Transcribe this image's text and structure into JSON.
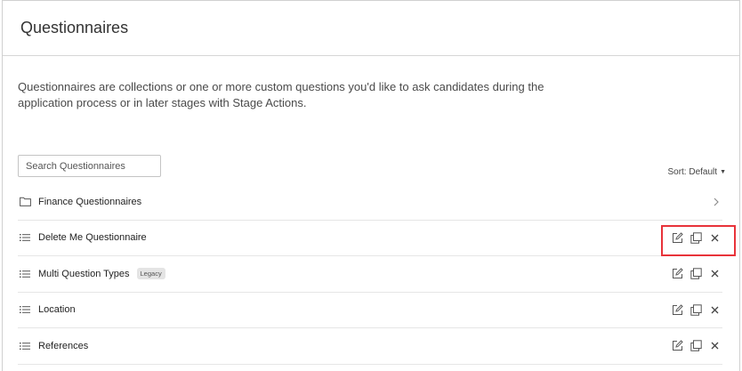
{
  "header": {
    "title": "Questionnaires"
  },
  "description": "Questionnaires are collections or one or more custom questions you'd like to ask candidates during the application process or in later stages with Stage Actions.",
  "search": {
    "placeholder": "Search Questionnaires",
    "value": ""
  },
  "sort": {
    "label": "Sort: Default"
  },
  "list": {
    "items": [
      {
        "label": "Finance Questionnaires",
        "icon": "folder-icon",
        "type": "folder"
      },
      {
        "label": "Delete Me Questionnaire",
        "icon": "list-icon",
        "type": "questionnaire"
      },
      {
        "label": "Multi Question Types",
        "icon": "list-icon",
        "type": "questionnaire",
        "badge": "Legacy"
      },
      {
        "label": "Location",
        "icon": "list-icon",
        "type": "questionnaire"
      },
      {
        "label": "References",
        "icon": "list-icon",
        "type": "questionnaire"
      }
    ]
  },
  "colors": {
    "highlight": "#e8333a",
    "divider": "#e6e6e6",
    "text": "#333333"
  }
}
